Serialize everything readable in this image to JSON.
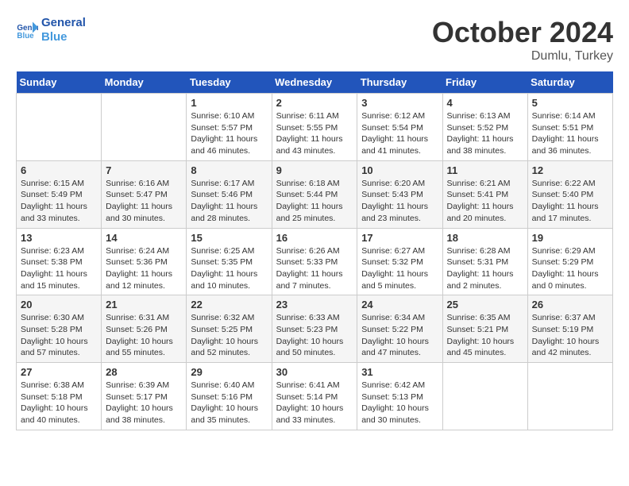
{
  "header": {
    "logo_line1": "General",
    "logo_line2": "Blue",
    "month_title": "October 2024",
    "location": "Dumlu, Turkey"
  },
  "weekdays": [
    "Sunday",
    "Monday",
    "Tuesday",
    "Wednesday",
    "Thursday",
    "Friday",
    "Saturday"
  ],
  "weeks": [
    [
      {
        "day": "",
        "info": ""
      },
      {
        "day": "",
        "info": ""
      },
      {
        "day": "1",
        "info": "Sunrise: 6:10 AM\nSunset: 5:57 PM\nDaylight: 11 hours and 46 minutes."
      },
      {
        "day": "2",
        "info": "Sunrise: 6:11 AM\nSunset: 5:55 PM\nDaylight: 11 hours and 43 minutes."
      },
      {
        "day": "3",
        "info": "Sunrise: 6:12 AM\nSunset: 5:54 PM\nDaylight: 11 hours and 41 minutes."
      },
      {
        "day": "4",
        "info": "Sunrise: 6:13 AM\nSunset: 5:52 PM\nDaylight: 11 hours and 38 minutes."
      },
      {
        "day": "5",
        "info": "Sunrise: 6:14 AM\nSunset: 5:51 PM\nDaylight: 11 hours and 36 minutes."
      }
    ],
    [
      {
        "day": "6",
        "info": "Sunrise: 6:15 AM\nSunset: 5:49 PM\nDaylight: 11 hours and 33 minutes."
      },
      {
        "day": "7",
        "info": "Sunrise: 6:16 AM\nSunset: 5:47 PM\nDaylight: 11 hours and 30 minutes."
      },
      {
        "day": "8",
        "info": "Sunrise: 6:17 AM\nSunset: 5:46 PM\nDaylight: 11 hours and 28 minutes."
      },
      {
        "day": "9",
        "info": "Sunrise: 6:18 AM\nSunset: 5:44 PM\nDaylight: 11 hours and 25 minutes."
      },
      {
        "day": "10",
        "info": "Sunrise: 6:20 AM\nSunset: 5:43 PM\nDaylight: 11 hours and 23 minutes."
      },
      {
        "day": "11",
        "info": "Sunrise: 6:21 AM\nSunset: 5:41 PM\nDaylight: 11 hours and 20 minutes."
      },
      {
        "day": "12",
        "info": "Sunrise: 6:22 AM\nSunset: 5:40 PM\nDaylight: 11 hours and 17 minutes."
      }
    ],
    [
      {
        "day": "13",
        "info": "Sunrise: 6:23 AM\nSunset: 5:38 PM\nDaylight: 11 hours and 15 minutes."
      },
      {
        "day": "14",
        "info": "Sunrise: 6:24 AM\nSunset: 5:36 PM\nDaylight: 11 hours and 12 minutes."
      },
      {
        "day": "15",
        "info": "Sunrise: 6:25 AM\nSunset: 5:35 PM\nDaylight: 11 hours and 10 minutes."
      },
      {
        "day": "16",
        "info": "Sunrise: 6:26 AM\nSunset: 5:33 PM\nDaylight: 11 hours and 7 minutes."
      },
      {
        "day": "17",
        "info": "Sunrise: 6:27 AM\nSunset: 5:32 PM\nDaylight: 11 hours and 5 minutes."
      },
      {
        "day": "18",
        "info": "Sunrise: 6:28 AM\nSunset: 5:31 PM\nDaylight: 11 hours and 2 minutes."
      },
      {
        "day": "19",
        "info": "Sunrise: 6:29 AM\nSunset: 5:29 PM\nDaylight: 11 hours and 0 minutes."
      }
    ],
    [
      {
        "day": "20",
        "info": "Sunrise: 6:30 AM\nSunset: 5:28 PM\nDaylight: 10 hours and 57 minutes."
      },
      {
        "day": "21",
        "info": "Sunrise: 6:31 AM\nSunset: 5:26 PM\nDaylight: 10 hours and 55 minutes."
      },
      {
        "day": "22",
        "info": "Sunrise: 6:32 AM\nSunset: 5:25 PM\nDaylight: 10 hours and 52 minutes."
      },
      {
        "day": "23",
        "info": "Sunrise: 6:33 AM\nSunset: 5:23 PM\nDaylight: 10 hours and 50 minutes."
      },
      {
        "day": "24",
        "info": "Sunrise: 6:34 AM\nSunset: 5:22 PM\nDaylight: 10 hours and 47 minutes."
      },
      {
        "day": "25",
        "info": "Sunrise: 6:35 AM\nSunset: 5:21 PM\nDaylight: 10 hours and 45 minutes."
      },
      {
        "day": "26",
        "info": "Sunrise: 6:37 AM\nSunset: 5:19 PM\nDaylight: 10 hours and 42 minutes."
      }
    ],
    [
      {
        "day": "27",
        "info": "Sunrise: 6:38 AM\nSunset: 5:18 PM\nDaylight: 10 hours and 40 minutes."
      },
      {
        "day": "28",
        "info": "Sunrise: 6:39 AM\nSunset: 5:17 PM\nDaylight: 10 hours and 38 minutes."
      },
      {
        "day": "29",
        "info": "Sunrise: 6:40 AM\nSunset: 5:16 PM\nDaylight: 10 hours and 35 minutes."
      },
      {
        "day": "30",
        "info": "Sunrise: 6:41 AM\nSunset: 5:14 PM\nDaylight: 10 hours and 33 minutes."
      },
      {
        "day": "31",
        "info": "Sunrise: 6:42 AM\nSunset: 5:13 PM\nDaylight: 10 hours and 30 minutes."
      },
      {
        "day": "",
        "info": ""
      },
      {
        "day": "",
        "info": ""
      }
    ]
  ]
}
